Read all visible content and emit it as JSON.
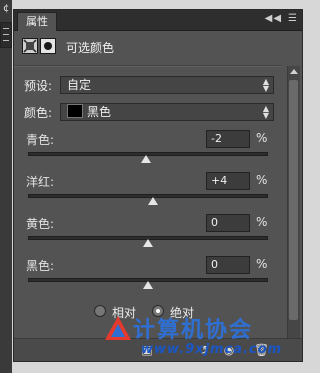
{
  "app": {
    "corner_hint": "¢"
  },
  "titlebar": {
    "tab_label": "属性",
    "collapse_icon": "double-chevron-left",
    "menu_icon": "panel-menu"
  },
  "header": {
    "title": "可选颜色",
    "icons": [
      "adjustment-icon",
      "mask-icon"
    ]
  },
  "preset": {
    "label": "预设:",
    "value": "自定"
  },
  "colors": {
    "label": "颜色:",
    "value": "黑色",
    "swatch": "#000000"
  },
  "sliders": [
    {
      "label": "青色:",
      "value": "-2",
      "unit": "%",
      "level": -2
    },
    {
      "label": "洋红:",
      "value": "+4",
      "unit": "%",
      "level": 4
    },
    {
      "label": "黄色:",
      "value": "0",
      "unit": "%",
      "level": 0
    },
    {
      "label": "黑色:",
      "value": "0",
      "unit": "%",
      "level": 0
    }
  ],
  "method": {
    "options": [
      {
        "label": "相对",
        "checked": false
      },
      {
        "label": "绝对",
        "checked": true
      }
    ]
  },
  "watermark": {
    "text": "计算机协会",
    "url": "www.9xjmca.com"
  },
  "theme": {
    "panel": "#535353",
    "titlebar": "#2e2e2e",
    "watermark": "#2f6fd1"
  }
}
